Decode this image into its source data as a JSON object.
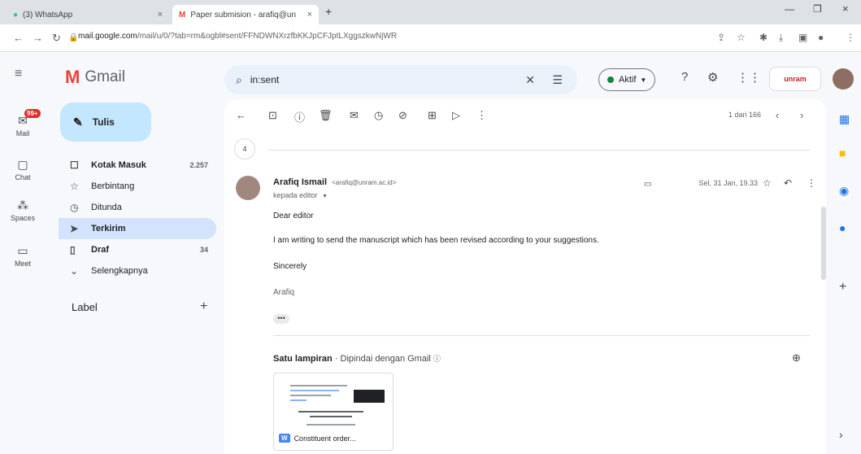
{
  "browser": {
    "tabs": [
      {
        "label": "(3) WhatsApp",
        "close": "×"
      },
      {
        "label": "Paper submision - arafiq@unram.",
        "close": "×"
      }
    ],
    "new_tab": "+",
    "url_host": "mail.google.com",
    "url_path": "/mail/u/0/?tab=rm&ogbl#sent/FFNDWNXrzfbKKJpCFJptLXggszkwNjWR"
  },
  "app": {
    "logo_text": "Gmail"
  },
  "rail": {
    "badge": "99+",
    "items": [
      {
        "label": "Mail"
      },
      {
        "label": "Chat"
      },
      {
        "label": "Spaces"
      },
      {
        "label": "Meet"
      }
    ]
  },
  "compose": {
    "label": "Tulis"
  },
  "nav": {
    "items": [
      {
        "label": "Kotak Masuk",
        "count": "2.257"
      },
      {
        "label": "Berbintang",
        "count": ""
      },
      {
        "label": "Ditunda",
        "count": ""
      },
      {
        "label": "Terkirim",
        "count": ""
      },
      {
        "label": "Draf",
        "count": "34"
      },
      {
        "label": "Selengkapnya",
        "count": ""
      }
    ],
    "label_heading": "Label",
    "label_add": "+"
  },
  "search": {
    "value": "in:sent"
  },
  "header": {
    "status": "Aktif"
  },
  "toolbar": {
    "pager": "1 dari 166"
  },
  "thread": {
    "collapsed_count": "4",
    "sender_name": "Arafiq Ismail",
    "sender_email": "<arafiq@unram.ac.id>",
    "recipient": "kepada editor",
    "date": "Sel, 31 Jan, 19.33",
    "greeting": "Dear editor",
    "body": "I am writing to send the manuscript which has been revised according to your suggestions.",
    "closing": "Sincerely",
    "signature": "Arafiq",
    "more_label": "•••"
  },
  "attachment": {
    "heading": "Satu lampiran",
    "subheading": "Dipindai dengan Gmail",
    "file_badge": "W",
    "file_name": "Constituent order..."
  }
}
